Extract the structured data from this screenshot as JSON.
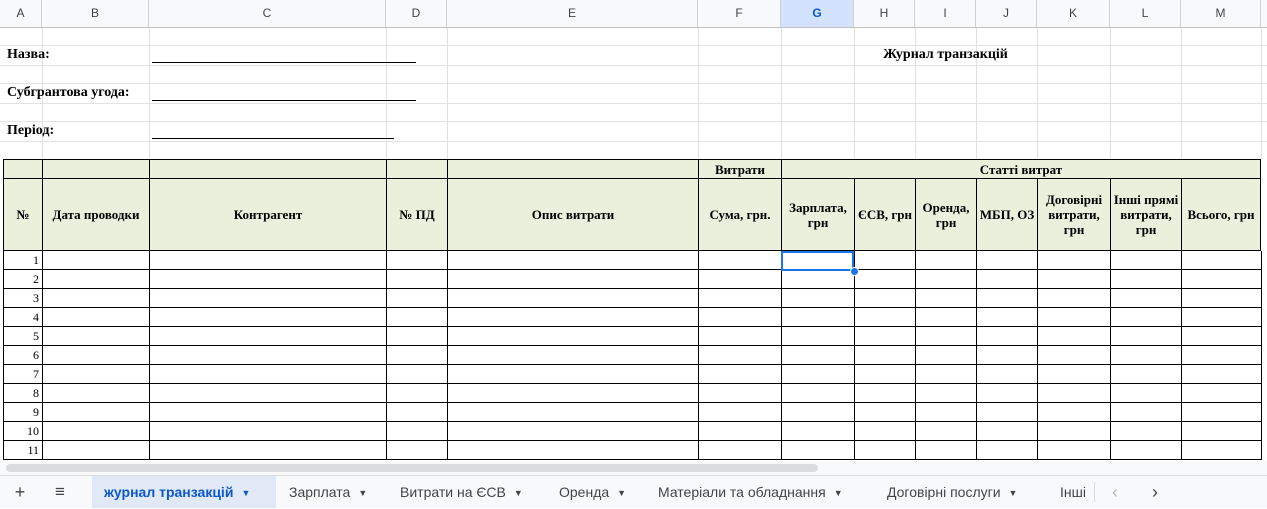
{
  "columns": [
    "A",
    "B",
    "C",
    "D",
    "E",
    "F",
    "G",
    "H",
    "I",
    "J",
    "K",
    "L",
    "M"
  ],
  "selected_column": "G",
  "form": {
    "name_label": "Назва:",
    "subgrant_label": "Субгрантова угода:",
    "period_label": "Період:",
    "journal_title": "Журнал транзакцій"
  },
  "header": {
    "group_expenses": "Витрати",
    "group_items": "Статті витрат",
    "no": "№",
    "posting_date": "Дата проводки",
    "counterparty": "Контрагент",
    "payment_doc": "№ ПД",
    "expense_desc": "Опис витрати",
    "amount": "Сума, грн.",
    "salary": "Зарплата, грн",
    "esv": "ЄСВ, грн",
    "rent": "Оренда, грн",
    "mbp": "МБП, ОЗ",
    "contract": "Договірні витрати, грн",
    "other": "Інші прямі витрати, грн",
    "total": "Всього, грн"
  },
  "rows": [
    "1",
    "2",
    "3",
    "4",
    "5",
    "6",
    "7",
    "8",
    "9",
    "10",
    "11"
  ],
  "tabs": {
    "items": [
      {
        "label": "журнал транзакцій",
        "active": true
      },
      {
        "label": "Зарплата"
      },
      {
        "label": "Витрати на ЄСВ"
      },
      {
        "label": "Оренда"
      },
      {
        "label": "Матеріали та обладнання"
      },
      {
        "label": "Договірні послуги"
      },
      {
        "label": "Інші"
      }
    ],
    "add_icon": "plus-icon",
    "menu_icon": "hamburger-icon"
  },
  "colors": {
    "header_fill": "#eaf0dc",
    "selection": "#1a73e8",
    "active_tab": "#0b57d0"
  }
}
